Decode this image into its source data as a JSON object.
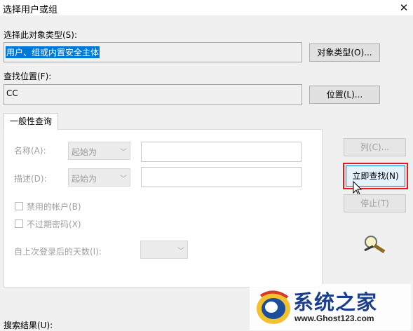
{
  "window": {
    "title": "选择用户或组",
    "close_glyph": "✕"
  },
  "object_type": {
    "label": "选择此对象类型(S):",
    "value": "用户、组或内置安全主体",
    "button": "对象类型(O)..."
  },
  "location": {
    "label": "查找位置(F):",
    "value": "CC",
    "button": "位置(L)..."
  },
  "tabs": [
    {
      "label": "一般性查询"
    }
  ],
  "query": {
    "name_label": "名称(A):",
    "name_mode": "起始为",
    "desc_label": "描述(D):",
    "desc_mode": "起始为",
    "disabled_accounts": "禁用的帐户(B)",
    "non_expiring_pwd": "不过期密码(X)",
    "days_since_logon": "自上次登录后的天数(I):"
  },
  "actions": {
    "columns": "列(C)...",
    "find_now": "立即查找(N)",
    "stop": "停止(T)"
  },
  "results_label": "搜索结果(U):",
  "watermark": {
    "text": "系统之家",
    "url": "www.Ghost123.com"
  },
  "colors": {
    "selection": "#0078d7",
    "highlight_border": "#e21b1b",
    "window_bg": "#f0f0f0"
  }
}
